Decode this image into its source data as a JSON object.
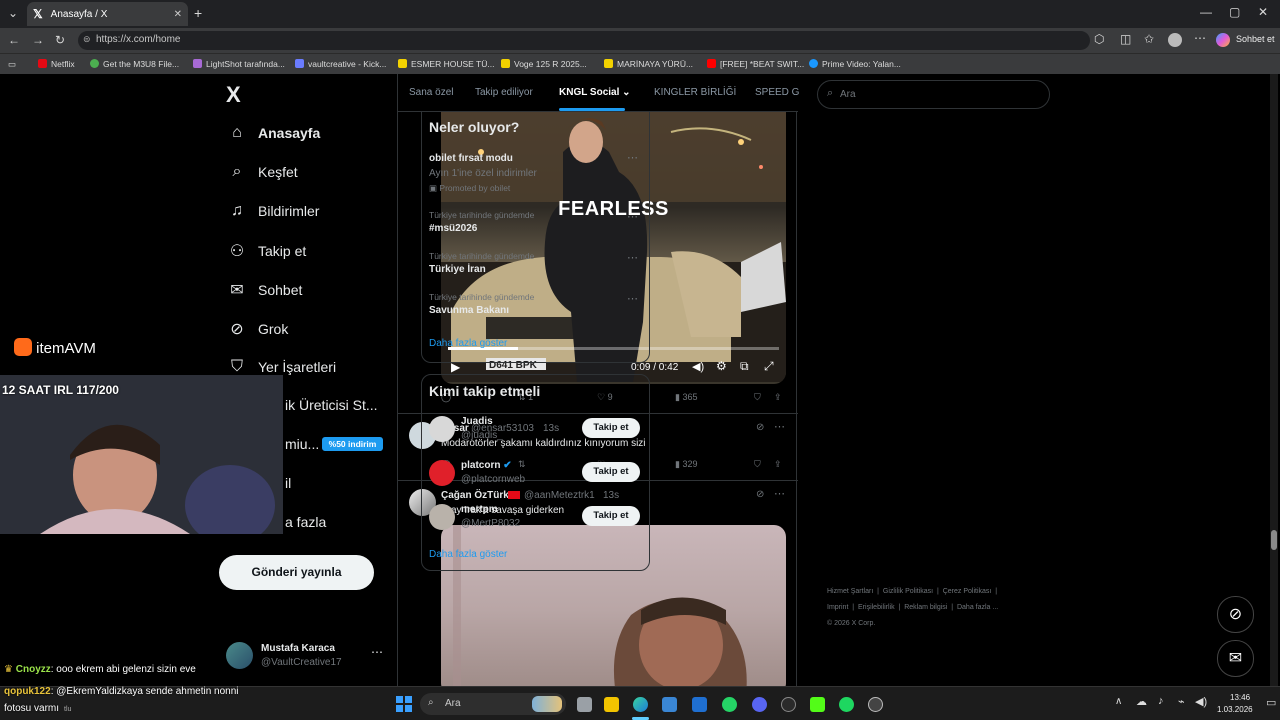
{
  "browser": {
    "tab_title": "Anasayfa / X",
    "url": "https://x.com/home",
    "chat_label": "Sohbet et",
    "bookmarks": [
      "Netflix",
      "Get the M3U8 File...",
      "LightShot tarafında...",
      "vaultcreative - Kick...",
      "ESMER HOUSE TÜ...",
      "Voge 125 R 2025...",
      "MARİNAYA YÜRÜ...",
      "[FREE] *BEAT SWIT...",
      "Prime Video: Yalan..."
    ]
  },
  "sidebar": {
    "logo": "X",
    "items": [
      {
        "label": "Anasayfa",
        "icon": "home-icon"
      },
      {
        "label": "Keşfet",
        "icon": "search-icon"
      },
      {
        "label": "Bildirimler",
        "icon": "bell-icon"
      },
      {
        "label": "Takip et",
        "icon": "add-person-icon"
      },
      {
        "label": "Sohbet",
        "icon": "mail-icon"
      },
      {
        "label": "Grok",
        "icon": "grok-icon"
      },
      {
        "label": "Yer İşaretleri",
        "icon": "bookmark-icon"
      },
      {
        "label": "ik Üreticisi St...",
        "icon": ""
      },
      {
        "label": "miu...",
        "icon": ""
      },
      {
        "label": "il",
        "icon": ""
      },
      {
        "label": "a fazla",
        "icon": ""
      }
    ],
    "premium_badge": "%50 indirim",
    "post_button": "Gönderi yayınla",
    "account": {
      "name": "Mustafa Karaca",
      "handle": "@VaultCreative17"
    }
  },
  "timeline": {
    "tabs": [
      "Sana özel",
      "Takip ediliyor",
      "KNGL Social",
      "KINGLER BİRLİĞİ",
      "SPEED G"
    ],
    "active_tab": "KNGL Social",
    "video1": {
      "overlay_text": "FEARLESS",
      "time": "0:09 / 0:42",
      "plate": "D641 BPK",
      "replies": "",
      "retweets": "1",
      "likes": "9",
      "views": "365",
      "progress": 0.21
    },
    "post2": {
      "name": "Ensar",
      "handle": "@ensar53103",
      "time": "13s",
      "text": "Modarotörler şakamı kaldırdınız kınıyorum sizi",
      "views": "329"
    },
    "post3": {
      "name": "Çağan ÖzTürk",
      "handle": "@aanMeteztrk1",
      "time": "13s",
      "text": "Eray Irak'a savaşa giderken"
    }
  },
  "right": {
    "search_placeholder": "Ara",
    "trends_title": "Neler oluyor?",
    "trends": [
      {
        "title": "obilet fırsat modu",
        "subtitle": "Ayın 1'ine özel indirimler",
        "promo": "Promoted by obilet"
      },
      {
        "context": "Türkiye tarihinde gündemde",
        "title": "#msü2026"
      },
      {
        "context": "Türkiye tarihinde gündemde",
        "title": "Türkiye İran"
      },
      {
        "context": "Türkiye tarihinde gündemde",
        "title": "Savunma Bakanı"
      }
    ],
    "show_more": "Daha fazla göster",
    "who_title": "Kimi takip etmeli",
    "who": [
      {
        "name": "Juadis",
        "handle": "@juadis_"
      },
      {
        "name": "platcorn",
        "handle": "@platcornweb"
      },
      {
        "name": "mertpm",
        "handle": "@MertP8032"
      }
    ],
    "follow_label": "Takip et",
    "footer": [
      "Hizmet Şartları",
      "Gizlilik Politikası",
      "Çerez Politikası",
      "Imprint",
      "Erişilebilirlik",
      "Reklam bilgisi",
      "Daha fazla ...",
      "© 2026 X Corp."
    ]
  },
  "stream": {
    "logo": "itemAVM",
    "title": "12 SAAT IRL 117/200",
    "chat": [
      {
        "user": "Cnoyzz",
        "text": ": ooo ekrem abi gelenzi sizin eve"
      },
      {
        "user": "qopuk122",
        "text": ": @EkremYaldizkaya sende ahmetin nonni"
      },
      {
        "user": "",
        "text": "fotosu varmı"
      }
    ],
    "small": "tlu"
  },
  "taskbar": {
    "search": "Ara",
    "time": "13:46",
    "date": "1.03.2026"
  }
}
